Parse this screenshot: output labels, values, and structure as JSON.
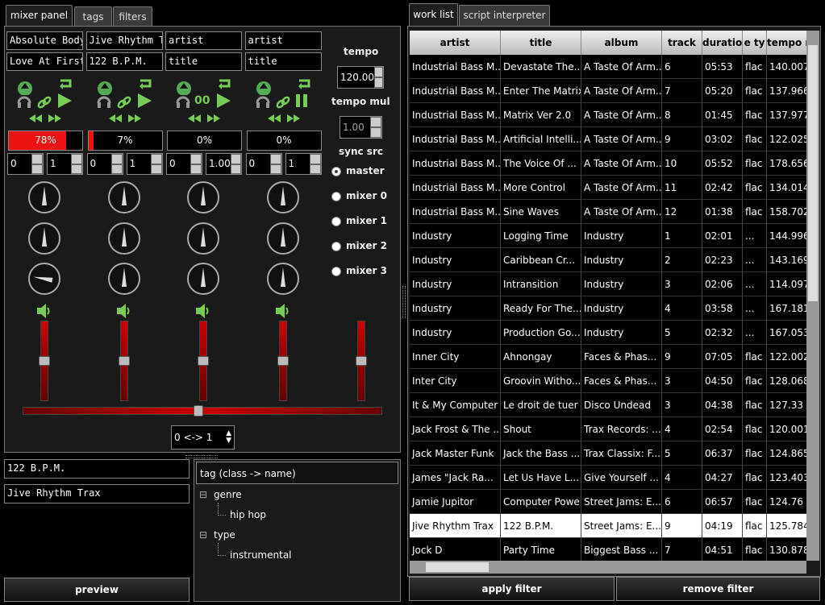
{
  "left_tabs": [
    "mixer panel",
    "tags",
    "filters"
  ],
  "right_tabs": [
    "work list",
    "script interpreter"
  ],
  "mixers": [
    {
      "artist": "Absolute Body",
      "title": "Love At First",
      "progress": "78%",
      "progress_value": 0.78,
      "spin_a": "0",
      "spin_b": "1",
      "paused": false,
      "toggle_icon": "link-icon"
    },
    {
      "artist": "Jive Rhythm T",
      "title": "122 B.P.M.",
      "progress": "7%",
      "progress_value": 0.07,
      "spin_a": "0",
      "spin_b": "1",
      "paused": false,
      "toggle_icon": "link-icon"
    },
    {
      "artist": "artist",
      "title": "title",
      "progress": "0%",
      "progress_value": 0,
      "spin_a": "0",
      "spin_b": "1.00",
      "paused": false,
      "toggle_icon": "00"
    },
    {
      "artist": "artist",
      "title": "title",
      "progress": "0%",
      "progress_value": 0,
      "spin_a": "0",
      "spin_b": "1",
      "paused": true,
      "toggle_icon": "link-icon"
    }
  ],
  "tempo": {
    "label": "tempo",
    "value": "120.00",
    "mul_label": "tempo mul",
    "mul_value": "1.00"
  },
  "sync": {
    "label": "sync src",
    "options": [
      "master",
      "mixer 0",
      "mixer 1",
      "mixer 2",
      "mixer 3"
    ],
    "selected": "master"
  },
  "crossfade_select": "0 <-> 1",
  "selected_track": {
    "title": "122 B.P.M.",
    "artist": "Jive Rhythm Trax"
  },
  "tag_tree": {
    "header": "tag (class -> name)",
    "items": [
      {
        "label": "genre",
        "level": 0,
        "expanded": true
      },
      {
        "label": "hip hop",
        "level": 1
      },
      {
        "label": "type",
        "level": 0,
        "expanded": true
      },
      {
        "label": "instrumental",
        "level": 1
      }
    ]
  },
  "preview_label": "preview",
  "worklist": {
    "columns": [
      "artist",
      "title",
      "album",
      "track",
      "duratio",
      "e ty",
      "tempo r"
    ],
    "rows": [
      [
        "Industrial Bass M...",
        "Devastate The...",
        "A Taste Of Arm...",
        "6",
        "05:53",
        "flac",
        "140.007"
      ],
      [
        "Industrial Bass M...",
        "Enter The Matrix",
        "A Taste Of Arm...",
        "7",
        "05:20",
        "flac",
        "137.966"
      ],
      [
        "Industrial Bass M...",
        "Matrix Ver 2.0",
        "A Taste Of Arm...",
        "8",
        "01:45",
        "flac",
        "137.977"
      ],
      [
        "Industrial Bass M...",
        "Artificial Intelli...",
        "A Taste Of Arm...",
        "9",
        "03:02",
        "flac",
        "122.025"
      ],
      [
        "Industrial Bass M...",
        "The Voice Of ...",
        "A Taste Of Arm...",
        "10",
        "05:52",
        "flac",
        "178.656"
      ],
      [
        "Industrial Bass M...",
        "More Control",
        "A Taste Of Arm...",
        "11",
        "02:42",
        "flac",
        "134.014"
      ],
      [
        "Industrial Bass M...",
        "Sine Waves",
        "A Taste Of Arm...",
        "12",
        "01:38",
        "flac",
        "158.702"
      ],
      [
        "Industry",
        "Logging Time",
        "Industry",
        "1",
        "02:01",
        "...",
        "144.996"
      ],
      [
        "Industry",
        "Caribbean Cr...",
        "Industry",
        "2",
        "02:23",
        "...",
        "143.169"
      ],
      [
        "Industry",
        "Intransition",
        "Industry",
        "3",
        "02:06",
        "...",
        "114.097"
      ],
      [
        "Industry",
        "Ready For The...",
        "Industry",
        "4",
        "03:58",
        "...",
        "167.181"
      ],
      [
        "Industry",
        "Production Go...",
        "Industry",
        "5",
        "02:32",
        "...",
        "167.053"
      ],
      [
        "Inner City",
        "Ahnongay",
        "Faces & Phas...",
        "9",
        "07:05",
        "flac",
        "122.002"
      ],
      [
        "Inter City",
        "Groovin Witho...",
        "Faces & Phas...",
        "3",
        "04:50",
        "flac",
        "128.068"
      ],
      [
        "It & My Computer",
        "Le droit de tuer",
        "Disco Undead",
        "3",
        "04:38",
        "flac",
        "127.33"
      ],
      [
        "Jack Frost & The ...",
        "Shout",
        "Trax Records: ...",
        "4",
        "02:54",
        "flac",
        "120.001"
      ],
      [
        "Jack Master Funk",
        "Jack the Bass ...",
        "Trax Classix: F...",
        "5",
        "06:37",
        "flac",
        "124.865"
      ],
      [
        "James \"Jack Ra...",
        "Let Us Have L...",
        "Give Yourself ...",
        "4",
        "04:27",
        "flac",
        "123.403"
      ],
      [
        "Jamie Jupitor",
        "Computer Power",
        "Street Jams: E...",
        "6",
        "06:57",
        "flac",
        "124.76"
      ],
      [
        "Jive Rhythm Trax",
        "122 B.P.M.",
        "Street Jams: E...",
        "9",
        "04:19",
        "flac",
        "125.784"
      ],
      [
        "Jock D",
        "Party Time",
        "Biggest Bass ...",
        "7",
        "04:51",
        "flac",
        "130.878"
      ]
    ],
    "selected_row": 19
  },
  "buttons": {
    "apply_filter": "apply filter",
    "remove_filter": "remove filter"
  }
}
